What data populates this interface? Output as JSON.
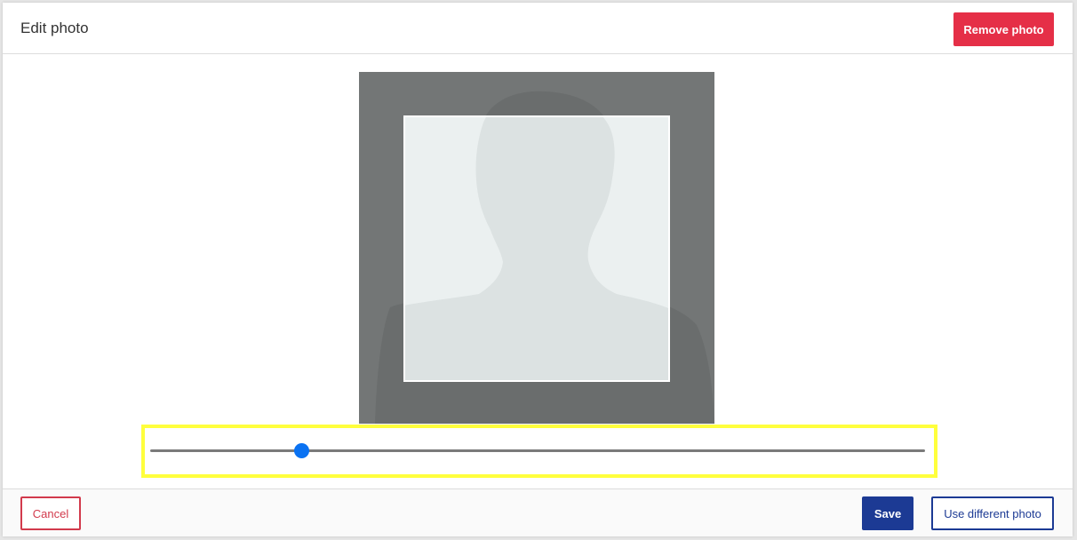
{
  "dialog": {
    "title": "Edit photo",
    "remove_label": "Remove photo"
  },
  "photo": {
    "placeholder_icon": "person-silhouette-icon"
  },
  "zoom_slider": {
    "value_fraction": 0.196
  },
  "footer": {
    "cancel_label": "Cancel",
    "save_label": "Save",
    "use_different_label": "Use different photo"
  },
  "colors": {
    "remove_button": "#e52f47",
    "primary": "#1c3a94",
    "cancel": "#d23a4c",
    "slider_thumb": "#0a72f2",
    "highlight": "#ffff3c"
  }
}
